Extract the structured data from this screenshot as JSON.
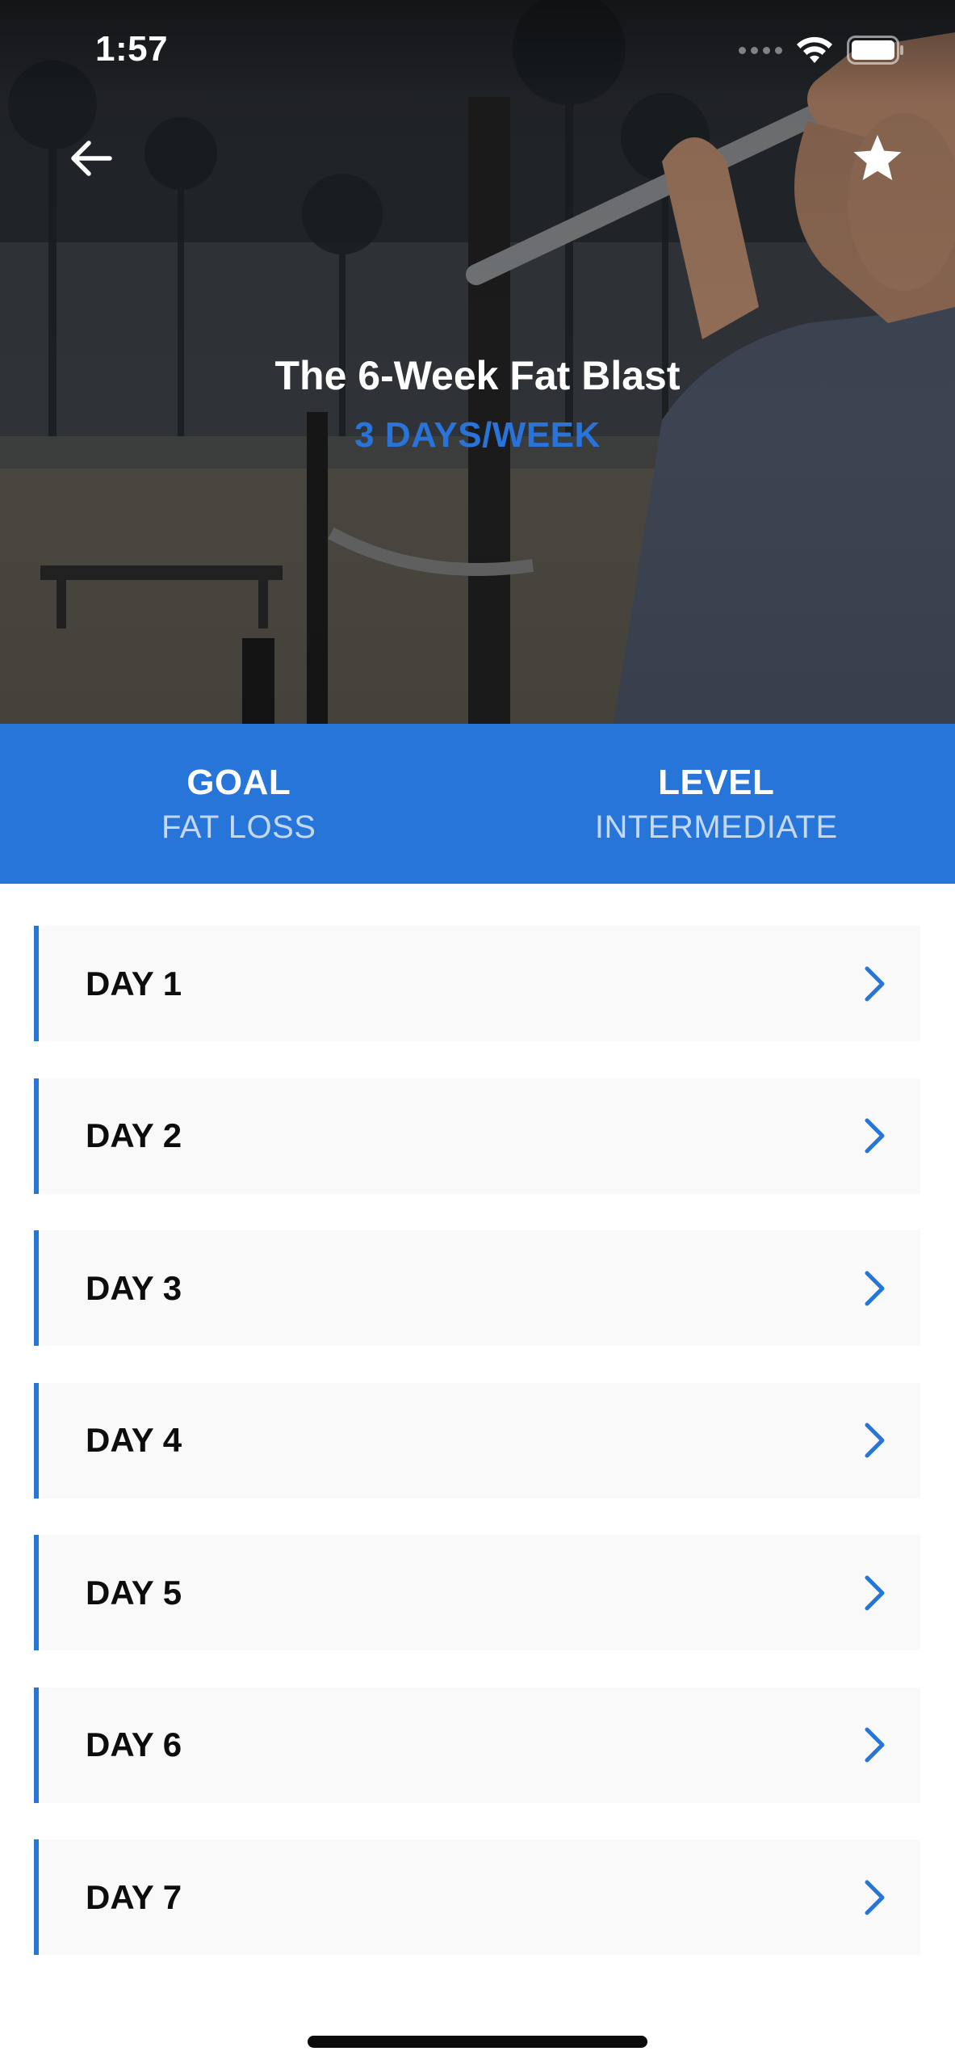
{
  "status_bar": {
    "time": "1:57"
  },
  "header": {
    "back_icon": "arrow-left-icon",
    "favorite_icon": "star-icon"
  },
  "program": {
    "title": "The 6-Week Fat Blast",
    "frequency": "3 DAYS/WEEK"
  },
  "info": {
    "goal_label": "GOAL",
    "goal_value": "FAT LOSS",
    "level_label": "LEVEL",
    "level_value": "INTERMEDIATE"
  },
  "days": [
    {
      "label": "DAY 1"
    },
    {
      "label": "DAY 2"
    },
    {
      "label": "DAY 3"
    },
    {
      "label": "DAY 4"
    },
    {
      "label": "DAY 5"
    },
    {
      "label": "DAY 6"
    },
    {
      "label": "DAY 7"
    }
  ],
  "colors": {
    "accent": "#2775d8",
    "row_background": "#f9f9f9",
    "text_dark": "#0d0d0d"
  }
}
